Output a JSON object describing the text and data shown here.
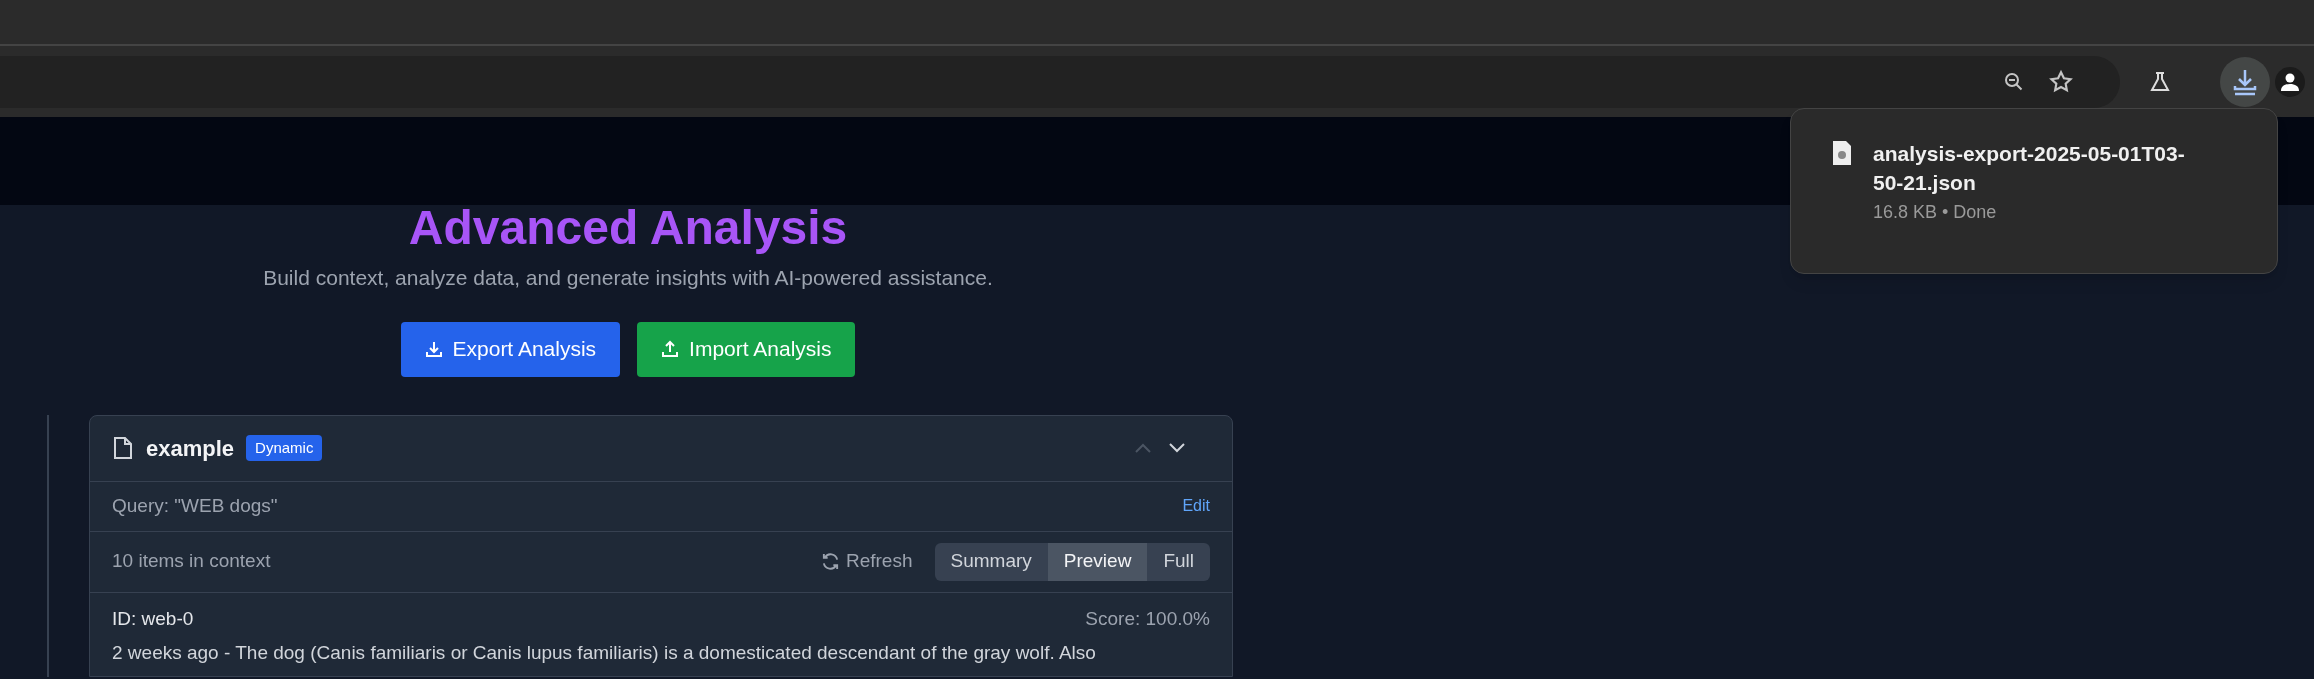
{
  "browser_toolbar": {
    "download_active": true
  },
  "download_popup": {
    "filename": "analysis-export-2025-05-01T03-50-21.json",
    "details": "16.8 KB • Done"
  },
  "header": {
    "title": "Advanced Analysis",
    "subtitle": "Build context, analyze data, and generate insights with AI-powered assistance."
  },
  "actions": [
    {
      "label": "Export Analysis",
      "kind": "export"
    },
    {
      "label": "Import Analysis",
      "kind": "import"
    }
  ],
  "context_card": {
    "name": "example",
    "badge": "Dynamic",
    "query": "Query: \"WEB dogs\"",
    "edit_link": "Edit",
    "item_count": "10 items in context",
    "refresh": "Refresh",
    "view_modes": [
      {
        "label": "Summary",
        "selected": false
      },
      {
        "label": "Preview",
        "selected": true
      },
      {
        "label": "Full",
        "selected": false
      }
    ],
    "items": [
      {
        "id": "ID: web-0",
        "score": "Score: 100.0%",
        "text": "2 weeks ago - The dog (Canis familiaris or Canis lupus familiaris) is a domesticated descendant of the gray wolf. Also"
      }
    ]
  }
}
